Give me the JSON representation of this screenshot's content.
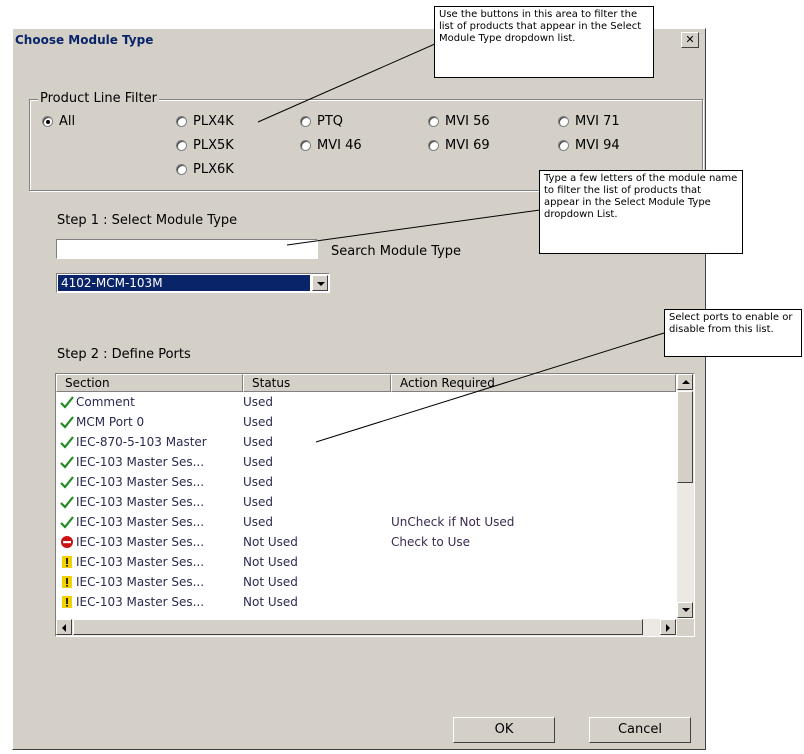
{
  "window": {
    "title": "Choose Module Type",
    "close_label": "✕"
  },
  "filter": {
    "legend": "Product Line Filter",
    "options": [
      "All",
      "PLX4K",
      "PTQ",
      "MVI 56",
      "MVI 71",
      "PLX5K",
      "MVI 46",
      "MVI 69",
      "MVI 94",
      "PLX6K"
    ],
    "selected": "All"
  },
  "step1": {
    "label": "Step 1 : Select Module Type",
    "search_label": "Search Module Type",
    "search_value": "",
    "selected_module": "4102-MCM-103M"
  },
  "step2": {
    "label": "Step 2 : Define Ports",
    "columns": [
      "Section",
      "Status",
      "Action Required"
    ],
    "rows": [
      {
        "icon": "check",
        "section": "Comment",
        "status": "Used",
        "action": ""
      },
      {
        "icon": "check",
        "section": "MCM Port 0",
        "status": "Used",
        "action": ""
      },
      {
        "icon": "check",
        "section": "IEC-870-5-103 Master",
        "status": "Used",
        "action": ""
      },
      {
        "icon": "check",
        "section": "IEC-103 Master Ses...",
        "status": "Used",
        "action": ""
      },
      {
        "icon": "check",
        "section": "IEC-103 Master Ses...",
        "status": "Used",
        "action": ""
      },
      {
        "icon": "check",
        "section": "IEC-103 Master Ses...",
        "status": "Used",
        "action": ""
      },
      {
        "icon": "check",
        "section": "IEC-103 Master Ses...",
        "status": "Used",
        "action": "UnCheck if Not Used"
      },
      {
        "icon": "stop",
        "section": "IEC-103 Master Ses...",
        "status": "Not Used",
        "action": "Check to Use"
      },
      {
        "icon": "warning",
        "section": "IEC-103 Master Ses...",
        "status": "Not Used",
        "action": ""
      },
      {
        "icon": "warning",
        "section": "IEC-103 Master Ses...",
        "status": "Not Used",
        "action": ""
      },
      {
        "icon": "warning",
        "section": "IEC-103 Master Ses...",
        "status": "Not Used",
        "action": ""
      }
    ]
  },
  "buttons": {
    "ok": "OK",
    "cancel": "Cancel"
  },
  "callouts": {
    "filter": "Use the buttons in this area to filter the list of products that appear in the Select Module Type dropdown list.",
    "search": "Type a few letters of the module name to filter the list of products that appear in the Select Module Type dropdown List.",
    "ports": "Select ports to enable or disable from this list."
  },
  "colors": {
    "check": "#1f8a1f",
    "stop": "#cc1111",
    "warning": "#f2d200",
    "selection": "#0a246a"
  }
}
